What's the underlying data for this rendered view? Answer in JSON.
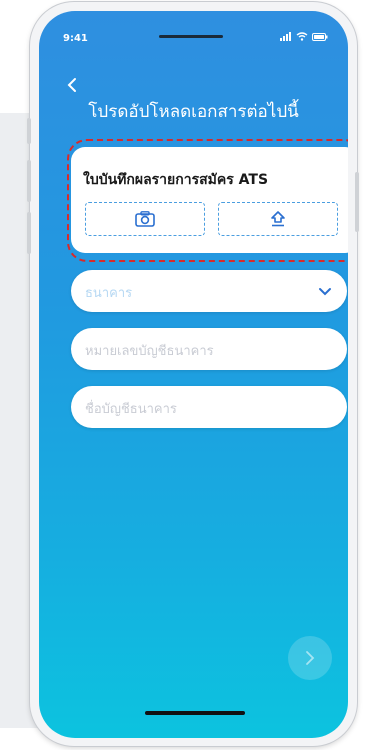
{
  "status_bar": {
    "time": "9:41",
    "icons": [
      "cellular-signal-icon",
      "wifi-icon",
      "battery-icon"
    ]
  },
  "nav": {
    "back_icon": "chevron-left-icon"
  },
  "page": {
    "title": "โปรดอัปโหลดเอกสารต่อไปนี้"
  },
  "ats_card": {
    "title": "ใบบันทึกผลรายการสมัคร ATS",
    "camera_icon": "camera-icon",
    "upload_icon": "upload-icon"
  },
  "form": {
    "bank_select_placeholder": "ธนาคาร",
    "account_number_placeholder": "หมายเลขบัญชีธนาคาร",
    "account_name_placeholder": "ชื่อบัญชีธนาคาร"
  },
  "footer": {
    "next_icon": "chevron-right-icon"
  },
  "colors": {
    "gradient_top": "#2f8fe0",
    "gradient_bottom": "#0cc3df",
    "highlight": "#d92a2a",
    "accent": "#4a9ee0"
  }
}
